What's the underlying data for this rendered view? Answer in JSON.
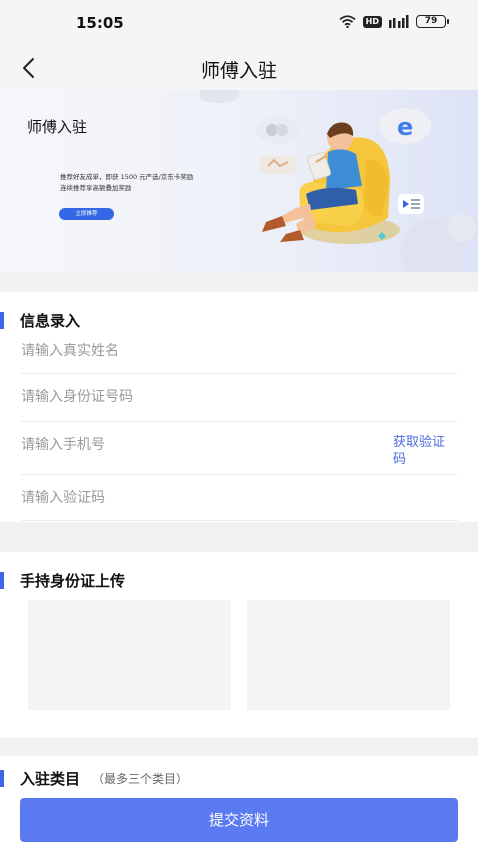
{
  "status_bar": {
    "time": "15:05",
    "network_badge": "HD",
    "battery": "79"
  },
  "nav": {
    "title": "师傅入驻"
  },
  "banner": {
    "title": "师傅入驻",
    "text_line1": "推荐好友成单，即获 1500 元严选/京东卡奖励",
    "text_line2": "连续推荐享高额叠加奖励",
    "button_label": "立即推荐"
  },
  "info_section": {
    "title": "信息录入",
    "name_placeholder": "请输入真实姓名",
    "id_placeholder": "请输入身份证号码",
    "phone_placeholder": "请输入手机号",
    "get_code_label": "获取验证码",
    "code_placeholder": "请输入验证码"
  },
  "id_section": {
    "title": "手持身份证上传"
  },
  "category_section": {
    "title": "入驻类目",
    "note": "（最多三个类目）"
  },
  "submit": {
    "label": "提交资料"
  },
  "colors": {
    "accent": "#3f63e6",
    "button": "#5b79f0",
    "link": "#4a6be0"
  }
}
